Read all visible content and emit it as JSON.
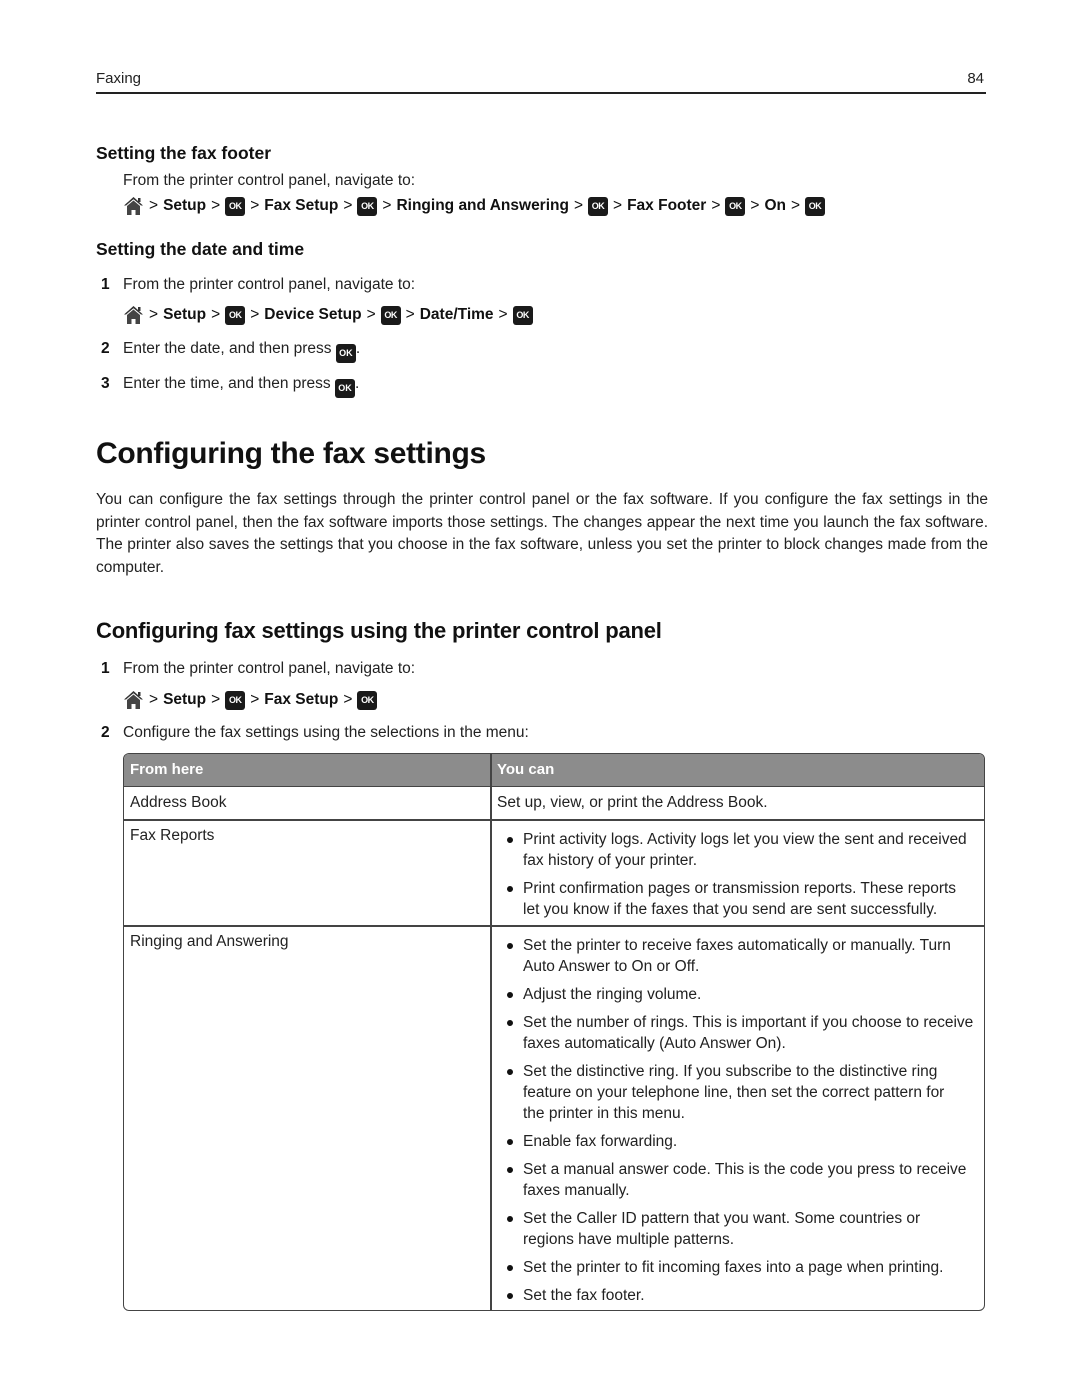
{
  "header": {
    "section": "Faxing",
    "page_number": "84"
  },
  "fax_footer": {
    "heading": "Setting the fax footer",
    "intro": "From the printer control panel, navigate to:",
    "path": [
      "Setup",
      "Fax Setup",
      "Ringing and Answering",
      "Fax Footer",
      "On"
    ]
  },
  "date_time": {
    "heading": "Setting the date and time",
    "steps": [
      {
        "num": "1",
        "text": "From the printer control panel, navigate to:"
      },
      {
        "num": "2",
        "text": "Enter the date, and then press",
        "suffix": "."
      },
      {
        "num": "3",
        "text": "Enter the time, and then press",
        "suffix": "."
      }
    ],
    "path": [
      "Setup",
      "Device Setup",
      "Date/Time"
    ]
  },
  "configuring": {
    "heading": "Configuring the fax settings",
    "paragraph": "You can configure the fax settings through the printer control panel or the fax software. If you configure the fax settings in the printer control panel, then the fax software imports those settings. The changes appear the next time you launch the fax software. The printer also saves the settings that you choose in the fax software, unless you set the printer to block changes made from the computer."
  },
  "control_panel": {
    "heading": "Configuring fax settings using the printer control panel",
    "steps": [
      {
        "num": "1",
        "text": "From the printer control panel, navigate to:"
      },
      {
        "num": "2",
        "text": "Configure the fax settings using the selections in the menu:"
      }
    ],
    "path": [
      "Setup",
      "Fax Setup"
    ]
  },
  "icons": {
    "home": "home-icon",
    "ok": "ok-button-icon",
    "ok_label": "OK",
    "separator": ">"
  },
  "table": {
    "headers": [
      "From here",
      "You can"
    ],
    "rows": [
      {
        "from": "Address Book",
        "text": "Set up, view, or print the Address Book."
      },
      {
        "from": "Fax Reports",
        "bullets": [
          [
            "Print activity logs. Activity logs let you view the sent and received",
            "fax history of your printer."
          ],
          [
            "Print confirmation pages or transmission reports. These reports",
            "let you know if the faxes that you send are sent successfully."
          ]
        ]
      },
      {
        "from": "Ringing and Answering",
        "bullets": [
          [
            "Set the printer to receive faxes automatically or manually. Turn",
            "Auto Answer to On or Off."
          ],
          [
            "Adjust the ringing volume."
          ],
          [
            "Set the number of rings. This is important if you choose to receive",
            "faxes automatically (Auto Answer On)."
          ],
          [
            "Set the distinctive ring. If you subscribe to the distinctive ring",
            "feature on your telephone line, then set the correct pattern for",
            "the printer in this menu."
          ],
          [
            "Enable fax forwarding."
          ],
          [
            "Set a manual answer code. This is the code you press to receive",
            "faxes manually."
          ],
          [
            "Set the Caller ID pattern that you want. Some countries or",
            "regions have multiple patterns."
          ],
          [
            "Set the printer to fit incoming faxes into a page when printing."
          ],
          [
            "Set the fax footer."
          ]
        ]
      }
    ]
  }
}
